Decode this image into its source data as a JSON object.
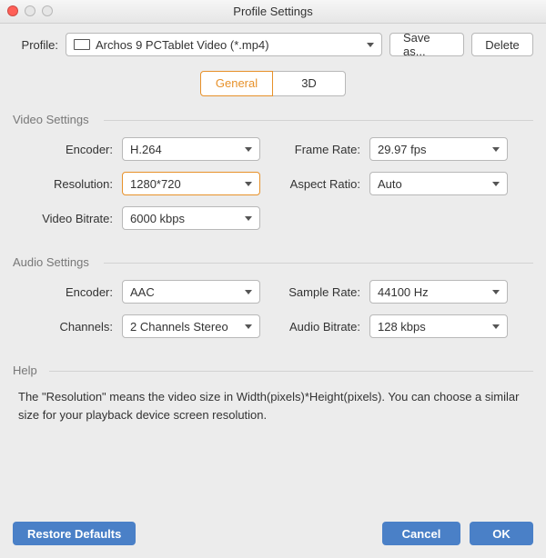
{
  "window": {
    "title": "Profile Settings"
  },
  "profile": {
    "label": "Profile:",
    "selected": "Archos 9 PCTablet Video (*.mp4)",
    "save_label": "Save as...",
    "delete_label": "Delete"
  },
  "tabs": {
    "general": "General",
    "three_d": "3D",
    "active": "general"
  },
  "video": {
    "title": "Video Settings",
    "encoder_label": "Encoder:",
    "encoder": "H.264",
    "framerate_label": "Frame Rate:",
    "framerate": "29.97 fps",
    "resolution_label": "Resolution:",
    "resolution": "1280*720",
    "aspect_label": "Aspect Ratio:",
    "aspect": "Auto",
    "bitrate_label": "Video Bitrate:",
    "bitrate": "6000 kbps"
  },
  "audio": {
    "title": "Audio Settings",
    "encoder_label": "Encoder:",
    "encoder": "AAC",
    "samplerate_label": "Sample Rate:",
    "samplerate": "44100 Hz",
    "channels_label": "Channels:",
    "channels": "2 Channels Stereo",
    "bitrate_label": "Audio Bitrate:",
    "bitrate": "128 kbps"
  },
  "help": {
    "title": "Help",
    "text": "The \"Resolution\" means the video size in Width(pixels)*Height(pixels).  You can choose a similar size for your playback device screen resolution."
  },
  "footer": {
    "restore": "Restore Defaults",
    "cancel": "Cancel",
    "ok": "OK"
  }
}
